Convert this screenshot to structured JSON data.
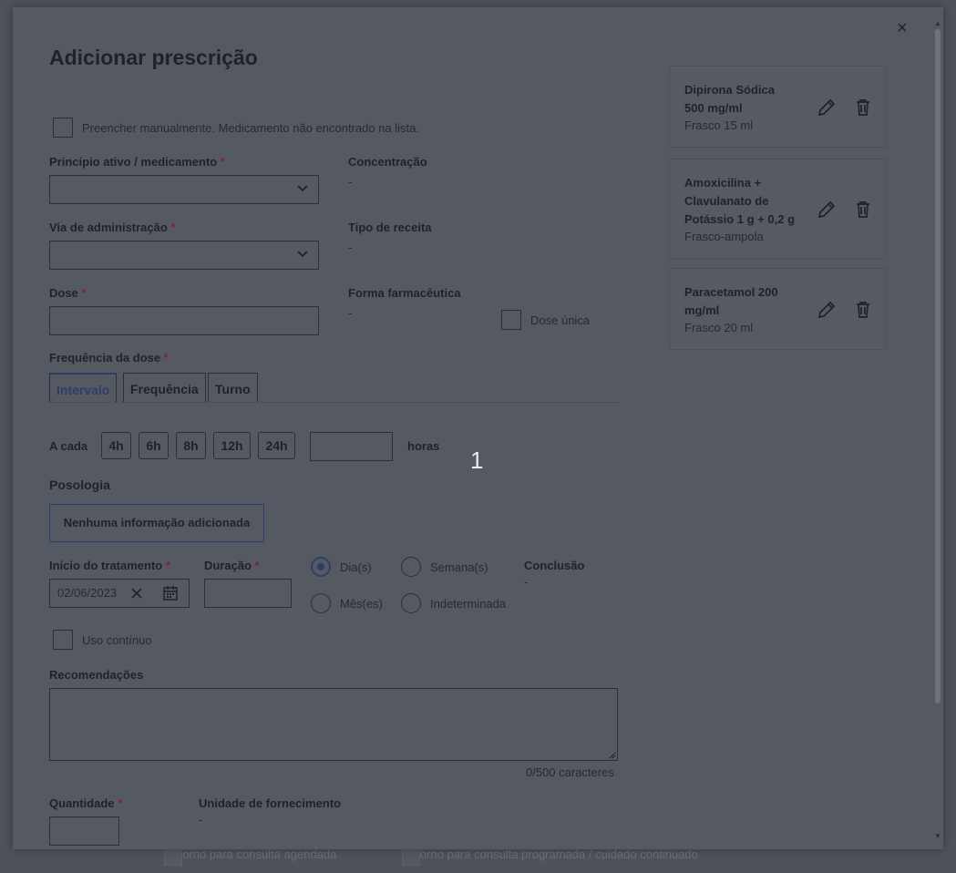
{
  "modal": {
    "title": "Adicionar prescrição",
    "close_label": "×",
    "manual_fill_label": "Preencher manualmente. Medicamento não encontrado na lista.",
    "fields": {
      "active_ingredient_label": "Princípio ativo / medicamento",
      "concentration_label": "Concentração",
      "concentration_value": "-",
      "route_label": "Via de administração",
      "prescription_type_label": "Tipo de receita",
      "prescription_type_value": "-",
      "dose_label": "Dose",
      "pharma_form_label": "Forma farmacêutica",
      "pharma_form_value": "-",
      "single_dose_label": "Dose única",
      "frequency_label": "Frequência da dose",
      "required_mark": "*"
    },
    "tabs": [
      {
        "label": "Intervalo",
        "active": true
      },
      {
        "label": "Frequência",
        "active": false
      },
      {
        "label": "Turno",
        "active": false
      }
    ],
    "interval": {
      "prefix": "A cada",
      "options": [
        "4h",
        "6h",
        "8h",
        "12h",
        "24h"
      ],
      "unit": "horas"
    },
    "posology": {
      "label": "Posologia",
      "button": "Nenhuma informação adicionada"
    },
    "treatment": {
      "start_label": "Início do tratamento",
      "start_value": "02/06/2023",
      "duration_label": "Duração",
      "units": [
        "Dia(s)",
        "Semana(s)",
        "Mês(es)",
        "Indeterminada"
      ],
      "selected_unit": "Dia(s)",
      "conclusion_label": "Conclusão",
      "conclusion_value": "-"
    },
    "continuous_use_label": "Uso contínuo",
    "recommendations": {
      "label": "Recomendações",
      "counter": "0/500 caracteres"
    },
    "quantity_label": "Quantidade",
    "supply_unit_label": "Unidade de fornecimento",
    "supply_unit_value": "-"
  },
  "prescriptions": [
    {
      "name_lines": [
        "Dipirona Sódica",
        "500 mg/ml"
      ],
      "form": "Frasco 15 ml"
    },
    {
      "name_lines": [
        "Amoxicilina +",
        "Clavulanato de",
        "Potássio 1 g + 0,2 g"
      ],
      "form": "Frasco-ampola"
    },
    {
      "name_lines": [
        "Paracetamol 200",
        "mg/ml"
      ],
      "form": "Frasco 20 ml"
    }
  ],
  "background": {
    "return_scheduled": "Retorno para consulta agendada",
    "return_programmed": "Retorno para consulta programada / cuidado continuado"
  },
  "overlay_number": "1",
  "colors": {
    "overlay": "#4f5359",
    "accent": "#2c3f6a",
    "required": "#7a2a26"
  }
}
